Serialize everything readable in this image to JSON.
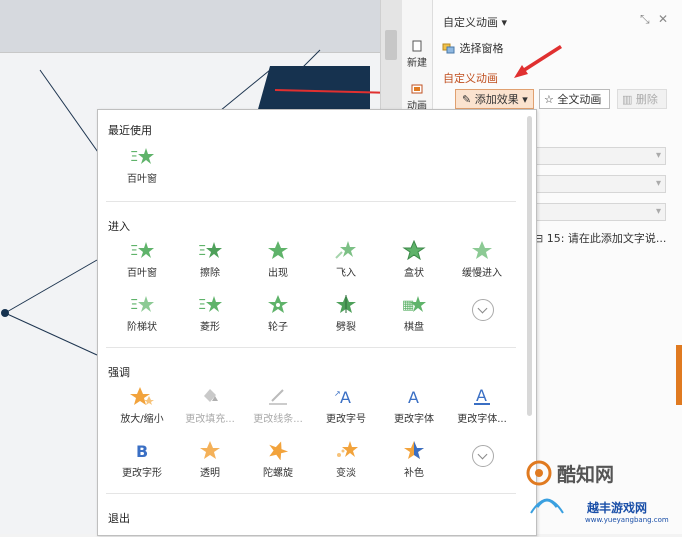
{
  "toolbar": {
    "new_label": "新建",
    "animation_label": "动画"
  },
  "panel": {
    "title": "自定义动画",
    "select_pane": "选择窗格",
    "custom_animation": "自定义动画",
    "add_effect": "添加效果",
    "full_text_animation": "全文动画",
    "delete": "删除",
    "list_item": "15: 请在此添加文字说..."
  },
  "menu": {
    "sections": [
      {
        "title": "最近使用",
        "items": [
          {
            "label": "百叶窗",
            "icon": "blinds-icon"
          }
        ]
      },
      {
        "title": "进入",
        "items": [
          {
            "label": "百叶窗",
            "icon": "blinds-icon"
          },
          {
            "label": "擦除",
            "icon": "wipe-icon"
          },
          {
            "label": "出现",
            "icon": "appear-icon"
          },
          {
            "label": "飞入",
            "icon": "fly-in-icon"
          },
          {
            "label": "盒状",
            "icon": "box-icon"
          },
          {
            "label": "缓慢进入",
            "icon": "crawl-in-icon"
          },
          {
            "label": "阶梯状",
            "icon": "step-icon"
          },
          {
            "label": "菱形",
            "icon": "diamond-icon"
          },
          {
            "label": "轮子",
            "icon": "wheel-icon"
          },
          {
            "label": "劈裂",
            "icon": "split-icon"
          },
          {
            "label": "棋盘",
            "icon": "checkerboard-icon"
          }
        ]
      },
      {
        "title": "强调",
        "items": [
          {
            "label": "放大/缩小",
            "icon": "grow-shrink-icon",
            "disabled": false
          },
          {
            "label": "更改填充...",
            "icon": "fill-color-icon",
            "disabled": true
          },
          {
            "label": "更改线条...",
            "icon": "line-color-icon",
            "disabled": true
          },
          {
            "label": "更改字号",
            "icon": "font-size-icon",
            "disabled": false
          },
          {
            "label": "更改字体",
            "icon": "font-icon",
            "disabled": false
          },
          {
            "label": "更改字体...",
            "icon": "font-color-icon",
            "disabled": false
          },
          {
            "label": "更改字形",
            "icon": "font-style-icon",
            "disabled": false
          },
          {
            "label": "透明",
            "icon": "transparency-icon",
            "disabled": false
          },
          {
            "label": "陀螺旋",
            "icon": "spin-icon",
            "disabled": false
          },
          {
            "label": "变淡",
            "icon": "fade-icon",
            "disabled": false
          },
          {
            "label": "补色",
            "icon": "complement-color-icon",
            "disabled": false
          }
        ]
      },
      {
        "title": "退出",
        "items": []
      }
    ]
  },
  "watermark": {
    "brand": "酷知网",
    "sub": "越丰游戏网",
    "url": "www.yueyangbang.com"
  },
  "colors": {
    "star_green": "#5fb36a",
    "star_orange": "#f2a33c",
    "font_blue": "#3a6fc4",
    "arrow_red": "#e03030",
    "slide_navy": "#16324f"
  }
}
